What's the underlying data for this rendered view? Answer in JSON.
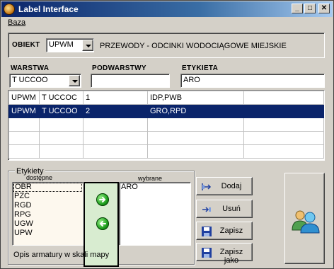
{
  "window": {
    "title": "Label Interface"
  },
  "titlebar_buttons": {
    "minimize": "_",
    "maximize": "□",
    "close": "✕"
  },
  "menu": {
    "items": [
      "Baza"
    ]
  },
  "obiekt": {
    "label": "OBIEKT",
    "value": "UPWM",
    "description": "PRZEWODY - ODCINKI WODOCIĄGOWE MIEJSKIE"
  },
  "filters": {
    "warstwa": {
      "label": "WARSTWA",
      "value": "T UCCOO"
    },
    "podwarstwy": {
      "label": "PODWARSTWY",
      "value": ""
    },
    "etykieta": {
      "label": "ETYKIETA",
      "value": "ARO"
    }
  },
  "grid": {
    "rows": [
      [
        "UPWM",
        "T UCCOC",
        "1",
        "IDP,PWB"
      ],
      [
        "UPWM",
        "T UCCOO",
        "2",
        "GRO,RPD"
      ],
      [
        "",
        "",
        "",
        ""
      ],
      [
        "",
        "",
        "",
        ""
      ],
      [
        "",
        "",
        "",
        ""
      ]
    ],
    "selected_row": 1
  },
  "etykiety": {
    "title": "Etykiety",
    "available_header": "dostępne",
    "selected_header": "wybrane",
    "available": [
      "OBR",
      "PZC",
      "RGD",
      "RPG",
      "UGW",
      "UPW"
    ],
    "selected": [
      "ARO"
    ],
    "description": "Opis armatury w skali mapy"
  },
  "buttons": {
    "dodaj": "Dodaj",
    "usun": "Usuń",
    "zapisz": "Zapisz",
    "zapisz_jako": "Zapisz jako"
  },
  "colors": {
    "titlebar_start": "#0a246a",
    "selection": "#0a246a",
    "face": "#d4d0c8",
    "list_bg": "#fdf8ee",
    "mid_panel": "#d8ecd0"
  },
  "icons": {
    "app": "app-globe-icon",
    "add": "add-arrow-icon",
    "remove": "remove-arrow-icon",
    "save": "floppy-disk-icon",
    "save_as": "floppy-disk-icon",
    "move_right": "green-arrow-right-icon",
    "move_left": "green-arrow-left-icon",
    "users": "users-icon"
  }
}
